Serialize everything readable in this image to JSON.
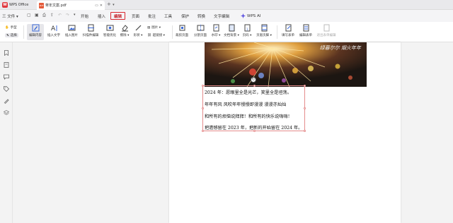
{
  "titlebar": {
    "app_name": "WPS Office",
    "doc_tab": "蒋年文案.pdf",
    "new_tab": "+",
    "tab_menu": "▾"
  },
  "menubar": {
    "file_label": "三 文件 ▾",
    "items": [
      "开始",
      "插入",
      "编辑",
      "页面",
      "批注",
      "工具",
      "保护",
      "转换",
      "文字编辑"
    ],
    "active": "编辑",
    "ai_label": "WPS AI"
  },
  "ribbon": {
    "hand": "手型",
    "select": "选择",
    "edit_content": "编辑内容",
    "insert_text": "插入文字",
    "insert_image": "插入图片",
    "scan_edit": "扫描件编辑",
    "smart_optimize": "智能优化",
    "erase": "擦除 ▾",
    "shape": "形状 ▾",
    "image_dd": "图片 ▾",
    "hyperlink": "超链接 ▾",
    "crop_page": "裁剪页面",
    "split_page": "分割页面",
    "watermark": "水印 ▾",
    "bg": "文档背景 ▾",
    "header_footer": "页眉页脚 ▾",
    "page_num": "页码 ▾",
    "fill_form": "填写表单",
    "edit_form": "编辑表单",
    "exit_form": "退出表单编辑"
  },
  "document": {
    "image_caption": "绿暮尔尔  烟火年年",
    "lines": [
      "2024 年：愿眼里全是光芒，笑里全是坦荡。",
      "年年有风  风吹年年慢慢即漫漫  漫漫亦灿灿",
      "和所有的烦恼说拜拜！和所有的快乐说嗨嗨！",
      "把遗憾留在 2023 年，把新的开始留在 2024 年。"
    ]
  },
  "icons": [
    "pdf-icon",
    "hand-icon",
    "cursor-icon",
    "edit-content-icon",
    "text-icon",
    "image-icon",
    "scan-icon",
    "optimize-icon",
    "eraser-icon",
    "shape-icon",
    "crop-icon",
    "split-icon",
    "form-icon",
    "bookmark-icon",
    "thumbnail-icon",
    "comment-icon",
    "tag-icon",
    "signature-icon",
    "layers-icon"
  ],
  "colors": {
    "accent": "#d8262e",
    "wps_red": "#e0383e"
  }
}
